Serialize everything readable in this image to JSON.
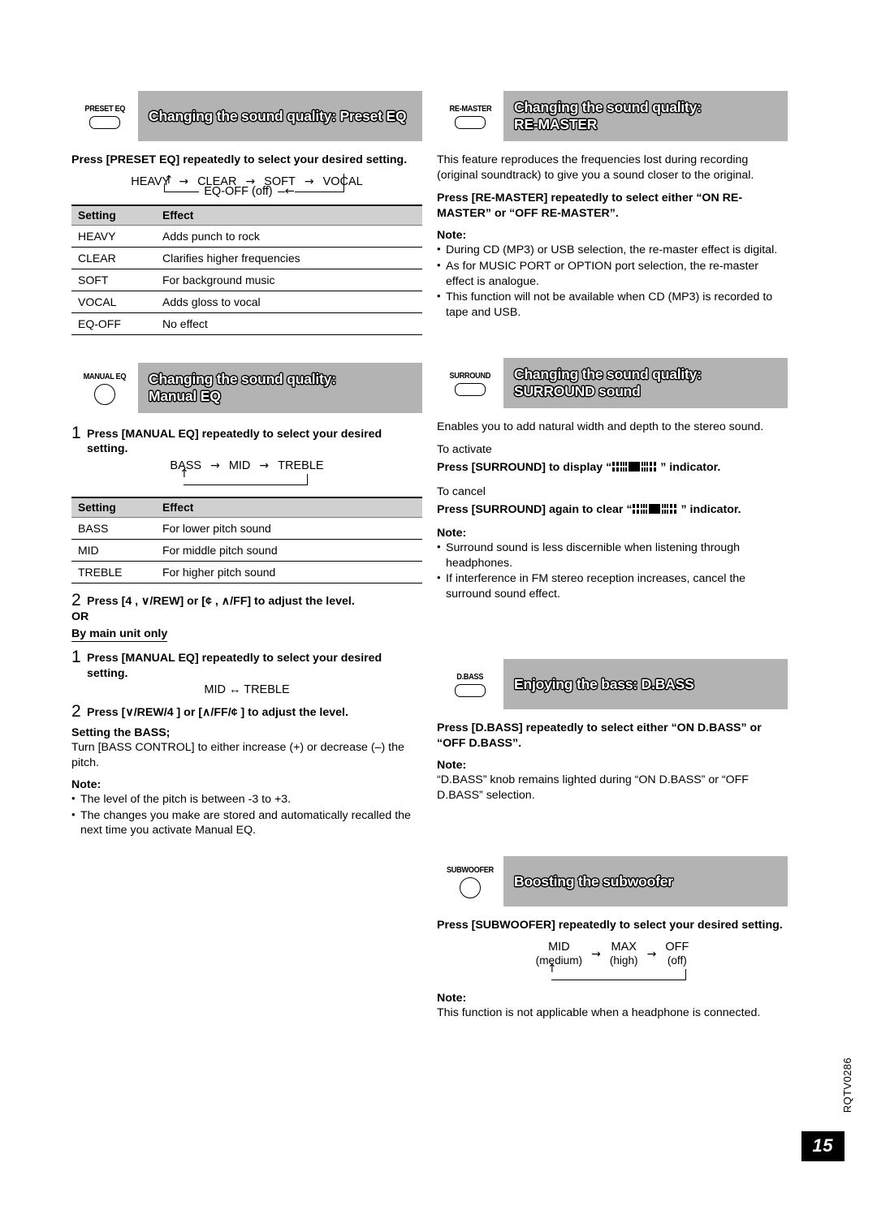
{
  "page": {
    "number": "15",
    "doc_code": "RQTV0286"
  },
  "sections": {
    "preset_eq": {
      "button_label": "PRESET EQ",
      "button_shape": "rounded-rect",
      "title_line1": "Changing the sound quality: Preset EQ",
      "title_line2": "",
      "instruction": "Press [PRESET EQ] repeatedly to select your desired setting.",
      "flow": [
        "HEAVY",
        "CLEAR",
        "SOFT",
        "VOCAL"
      ],
      "flow_return": "EQ-OFF (off)",
      "table": {
        "headers": [
          "Setting",
          "Effect"
        ],
        "rows": [
          [
            "HEAVY",
            "Adds punch to rock"
          ],
          [
            "CLEAR",
            "Clarifies higher frequencies"
          ],
          [
            "SOFT",
            "For background music"
          ],
          [
            "VOCAL",
            "Adds gloss to vocal"
          ],
          [
            "EQ-OFF",
            "No effect"
          ]
        ]
      }
    },
    "manual_eq": {
      "button_label": "MANUAL EQ",
      "button_shape": "circle",
      "title_line1": "Changing the sound quality:",
      "title_line2": "Manual EQ",
      "step1_num": "1",
      "step1_text": "Press [MANUAL EQ] repeatedly to select your desired setting.",
      "flow": [
        "BASS",
        "MID",
        "TREBLE"
      ],
      "table": {
        "headers": [
          "Setting",
          "Effect"
        ],
        "rows": [
          [
            "BASS",
            "For lower pitch sound"
          ],
          [
            "MID",
            "For middle pitch sound"
          ],
          [
            "TREBLE",
            "For higher pitch sound"
          ]
        ]
      },
      "step2_num": "2",
      "step2_text": "Press [4    , ∨/REW] or [¢    , ∧/FF] to adjust the level.",
      "or_label": "OR",
      "main_unit_only": "By main unit only",
      "mu_step1_num": "1",
      "mu_step1_text": "Press [MANUAL EQ] repeatedly to select your desired setting.",
      "mu_flow": "MID ↔ TREBLE",
      "mu_step2_num": "2",
      "mu_step2_text": "Press [∨/REW/4    ] or [∧/FF/¢    ] to adjust the level.",
      "setting_bass_head": "Setting the BASS;",
      "setting_bass_text": "Turn [BASS CONTROL] to either increase (+) or decrease (–) the pitch.",
      "note_head": "Note:",
      "notes": [
        "The level of the pitch is between -3 to +3.",
        "The changes you make are stored and automatically recalled the next time you activate Manual EQ."
      ]
    },
    "re_master": {
      "button_label": "RE-MASTER",
      "button_shape": "rounded-rect",
      "title_line1": "Changing the sound quality:",
      "title_line2": "RE-MASTER",
      "description": "This feature reproduces the frequencies lost during recording (original soundtrack) to give you a sound closer to the original.",
      "instruction": "Press [RE-MASTER] repeatedly to select either “ON RE-MASTER” or “OFF RE-MASTER”.",
      "note_head": "Note:",
      "notes": [
        "During CD (MP3) or USB selection, the re-master effect is digital.",
        "As for MUSIC PORT or OPTION port selection, the re-master effect is analogue.",
        "This function will not be available when CD (MP3) is recorded to tape and USB."
      ]
    },
    "surround": {
      "button_label": "SURROUND",
      "button_shape": "rounded-rect",
      "title_line1": "Changing the sound quality:",
      "title_line2": "SURROUND sound",
      "description": "Enables you to add natural width and depth to the stereo sound.",
      "activate_label": "To activate",
      "activate_text_before": "Press [SURROUND] to display “",
      "activate_text_after": "” indicator.",
      "cancel_label": "To cancel",
      "cancel_text_before": "Press [SURROUND] again to clear “",
      "cancel_text_after": "” indicator.",
      "indicator_name": "surround-matrix-indicator",
      "note_head": "Note:",
      "notes": [
        "Surround sound is less discernible when listening through headphones.",
        "If interference in FM stereo reception increases, cancel the surround sound effect."
      ]
    },
    "d_bass": {
      "button_label": "D.BASS",
      "button_shape": "rounded-rect",
      "title_line1": "Enjoying the bass: D.BASS",
      "title_line2": "",
      "instruction": "Press [D.BASS] repeatedly to select either “ON D.BASS” or “OFF D.BASS”.",
      "note_head": "Note:",
      "note_text": "“D.BASS” knob remains lighted during “ON D.BASS” or “OFF D.BASS” selection."
    },
    "subwoofer": {
      "button_label": "SUBWOOFER",
      "button_shape": "circle",
      "title_line1": "Boosting the subwoofer",
      "title_line2": "",
      "instruction": "Press [SUBWOOFER] repeatedly to select your desired setting.",
      "flow": [
        {
          "main": "MID",
          "sub": "(medium)"
        },
        {
          "main": "MAX",
          "sub": "(high)"
        },
        {
          "main": "OFF",
          "sub": "(off)"
        }
      ],
      "note_head": "Note:",
      "note_text": "This function is not applicable when a headphone is connected."
    }
  },
  "colors": {
    "header_bar": "#b3b3b3",
    "table_header": "#d0d0d0",
    "text": "#000000",
    "title_text": "#ffffff"
  }
}
